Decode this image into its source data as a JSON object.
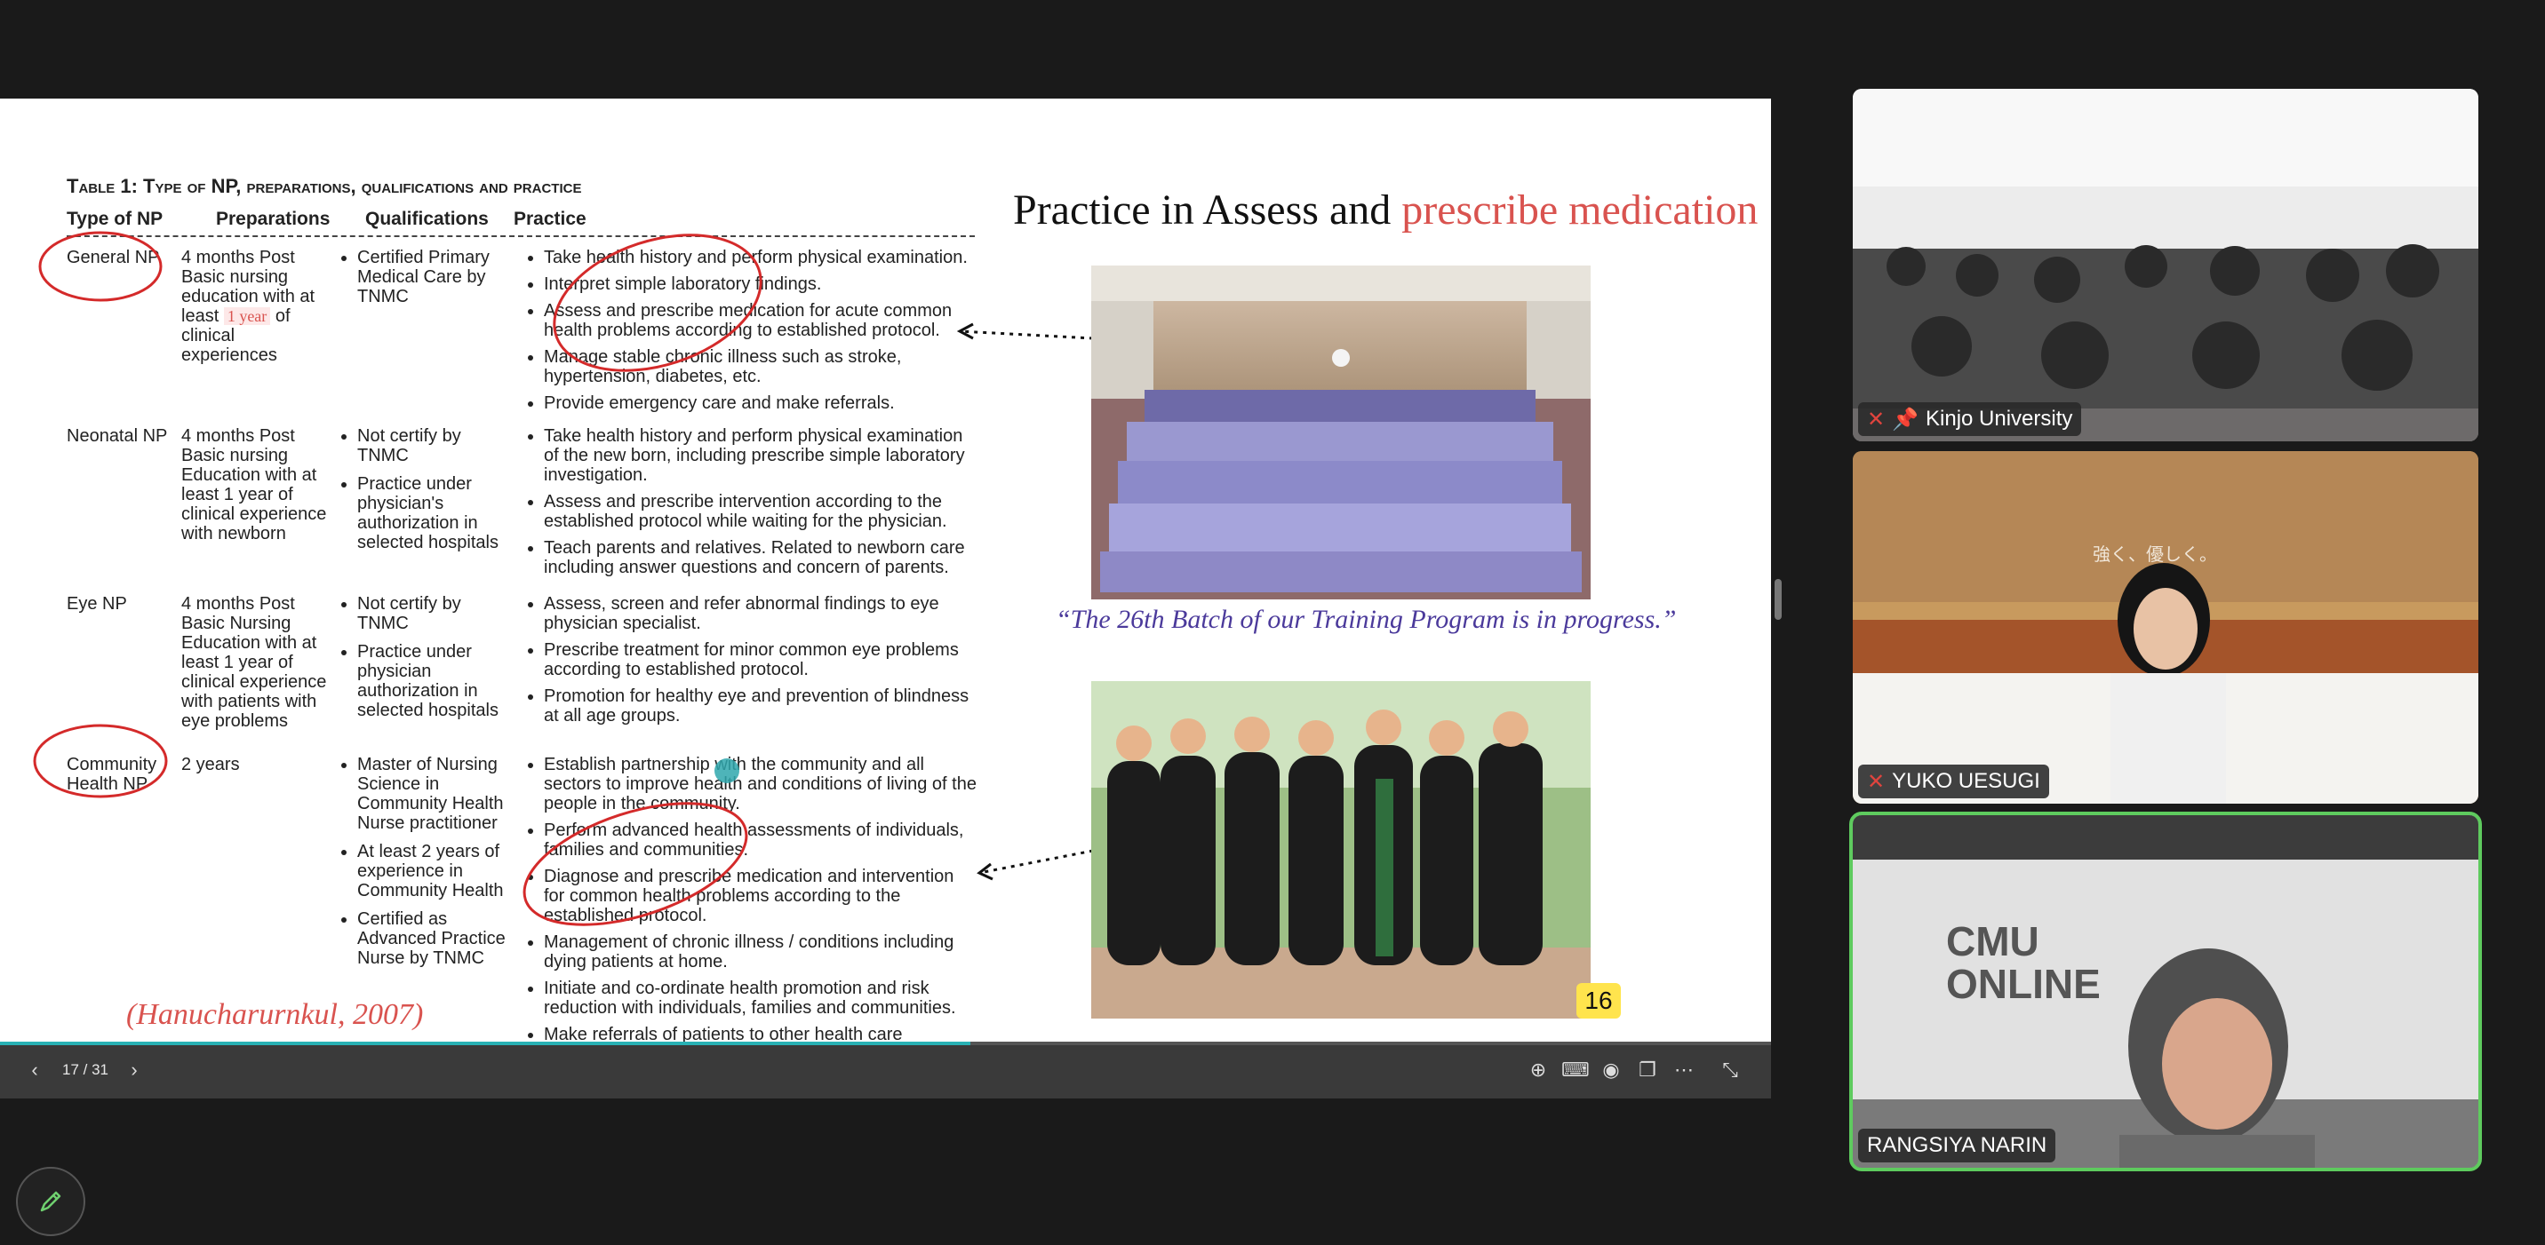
{
  "slide": {
    "table_title": "Table 1: Type of NP, preparations, qualifications and practice",
    "headers": [
      "Type of NP",
      "Preparations",
      "Qualifications",
      "Practice"
    ],
    "rows": [
      {
        "type": "General NP",
        "prep": [
          "4 months Post Basic nursing education with at least ",
          "1 year",
          " of clinical experiences"
        ],
        "quals": [
          "Certified Primary Medical Care by TNMC"
        ],
        "practice": [
          "Take health history and perform physical examination.",
          "Interpret simple laboratory findings.",
          "Assess and prescribe medication for acute common health problems according to established protocol.",
          "Manage stable chronic illness such as stroke, hypertension, diabetes, etc.",
          "Provide emergency care and make referrals."
        ]
      },
      {
        "type": "Neonatal NP",
        "prep": [
          "4 months Post Basic nursing Education with at least 1 year of clinical experience with newborn"
        ],
        "quals": [
          "Not certify by TNMC",
          "Practice under physician's authorization in selected hospitals"
        ],
        "practice": [
          "Take health history and perform physical examination of the new born, including prescribe simple laboratory investigation.",
          "Assess and prescribe intervention according to the established protocol while waiting for the physician.",
          "Teach parents and relatives. Related to newborn care including answer questions and concern of parents."
        ]
      },
      {
        "type": "Eye NP",
        "prep": [
          "4 months Post Basic Nursing Education with at least 1 year of clinical experience with patients with eye problems"
        ],
        "quals": [
          "Not certify by TNMC",
          "Practice under physician authorization in selected hospitals"
        ],
        "practice": [
          "Assess, screen and refer abnormal findings to eye physician specialist.",
          "Prescribe treatment for minor common eye problems according to established protocol.",
          "Promotion for healthy eye and prevention of blindness at all age groups."
        ]
      },
      {
        "type": "Community Health NP",
        "prep": [
          "2 years"
        ],
        "quals": [
          "Master of Nursing Science in Community Health Nurse practitioner",
          "At least 2 years of experience in Community Health",
          "Certified as Advanced Practice Nurse by TNMC"
        ],
        "practice": [
          "Establish partnership with the community and all sectors to improve health and conditions of living of the people in the community.",
          "Perform advanced health assessments of individuals, families and communities.",
          "Diagnose and prescribe medication and intervention for common health problems according to the established protocol.",
          "Management of chronic illness / conditions including dying patients at home.",
          "Initiate and co-ordinate health promotion and risk reduction with individuals, families and communities.",
          "Make referrals of patients to other health care providers when appropriate."
        ]
      }
    ],
    "title_part1": "Practice in Assess and ",
    "title_part2": "prescribe medication",
    "caption": "“The 26th Batch of our Training Program is in progress.”",
    "citation": "(Hanucharurnkul, 2007)",
    "page_number": "16",
    "highlight_2years": "2 years"
  },
  "toolbar": {
    "counter": "17 / 31",
    "progress": 0.548
  },
  "participants": [
    {
      "name": "Kinjo University",
      "muted": true,
      "pinned": true
    },
    {
      "name": "YUKO UESUGI",
      "muted": true,
      "pinned": false
    },
    {
      "name": "RANGSIYA NARIN",
      "muted": false,
      "pinned": false,
      "active_speaker": true
    }
  ],
  "tile2_sign": "強く、優しく。",
  "tile3_sign_line1": "CMU",
  "tile3_sign_line2": "ONLINE",
  "colors": {
    "accent": "#d9534f",
    "speaker_border": "#5ecb5e",
    "progress": "#28b1b4"
  }
}
